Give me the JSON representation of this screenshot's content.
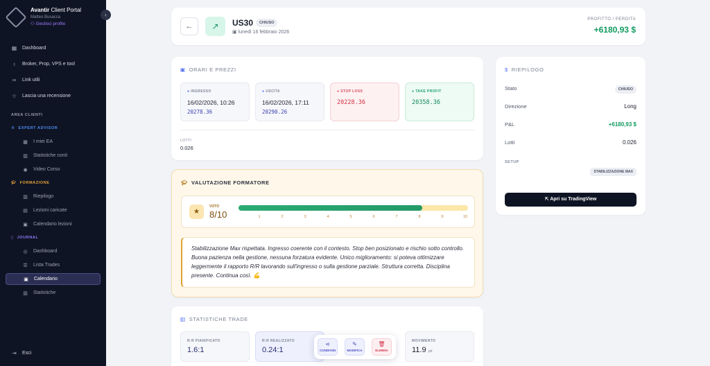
{
  "sidebar": {
    "brand_name": "Avantir",
    "brand_suffix": "Client Portal",
    "user_name": "Matteo Busacca",
    "manage_profile": "Gestisci profilo",
    "nav": [
      "Dashboard",
      "Broker, Prop, VPS e tool",
      "Link utili",
      "Lascia una recensione"
    ],
    "area_label": "AREA CLIENTI",
    "groups": {
      "expert": {
        "label": "EXPERT ADVISOR",
        "color": "#4e8df5",
        "items": [
          "I miei EA",
          "Statistiche conti",
          "Video Corso"
        ]
      },
      "formazione": {
        "label": "FORMAZIONE",
        "color": "#e8a43a",
        "items": [
          "Riepilogo",
          "Lezioni caricate",
          "Calendario lezioni"
        ]
      },
      "journal": {
        "label": "JOURNAL",
        "color": "#8b7cf6",
        "items": [
          "Dashboard",
          "Lista Trades",
          "Calendario",
          "Statistiche"
        ]
      }
    },
    "logout": "Esci"
  },
  "header": {
    "symbol": "US30",
    "status": "CHIUSO",
    "date": "lunedì 16 febbraio 2026",
    "pl_label": "PROFITTO / PERDITA",
    "pl_value": "+6180,93 $"
  },
  "prices": {
    "title": "ORARI E PREZZI",
    "entry": {
      "label": "INGRESSO",
      "datetime": "16/02/2026, 10:26",
      "price": "20278.36"
    },
    "exit": {
      "label": "USCITA",
      "datetime": "16/02/2026, 17:11",
      "price": "20290.26"
    },
    "stop_loss": {
      "label": "STOP LOSS",
      "price": "20228.36"
    },
    "take_profit": {
      "label": "TAKE PROFIT",
      "price": "20358.36"
    },
    "lots_label": "LOTTI",
    "lots_value": "0.026"
  },
  "evaluation": {
    "title": "VALUTAZIONE FORMATORE",
    "vote_label": "VOTO",
    "vote_display": "8/10",
    "score": 8,
    "max": 10,
    "ticks": [
      "1",
      "2",
      "3",
      "4",
      "5",
      "6",
      "7",
      "8",
      "9",
      "10"
    ],
    "comment": "Stabilizzazione Max rispettata. Ingresso coerente con il contesto. Stop ben posizionato e rischio sotto controllo. Buona pazienza nella gestione, nessuna forzatura evidente. Unico miglioramento: si poteva ottimizzare leggermente il rapporto R/R lavorando sull'ingresso o sulla gestione parziale. Struttura corretta. Disciplina presente. Continua così. 💪"
  },
  "stats": {
    "title": "STATISTICHE TRADE",
    "planned": {
      "label": "R:R PIANIFICATO",
      "value": "1.6:1"
    },
    "realized": {
      "label": "R:R REALIZZATO",
      "value": "0.24:1"
    },
    "movement": {
      "label": "MOVIMENTO",
      "value": "11.9",
      "unit": "pti"
    }
  },
  "actions": {
    "share": "CONDIVIDI",
    "edit": "MODIFICA",
    "delete": "ELIMINA"
  },
  "summary": {
    "title": "RIEPILOGO",
    "state_label": "Stato",
    "state_value": "CHIUSO",
    "direction_label": "Direzione",
    "direction_value": "Long",
    "pl_label": "P&L",
    "pl_value": "+6180,93 $",
    "lots_label": "Lotti",
    "lots_value": "0.026",
    "setup_label": "SETUP",
    "setup_value": "STABILIZZAZIONE MAX",
    "tv_button": "Apri su TradingView"
  }
}
